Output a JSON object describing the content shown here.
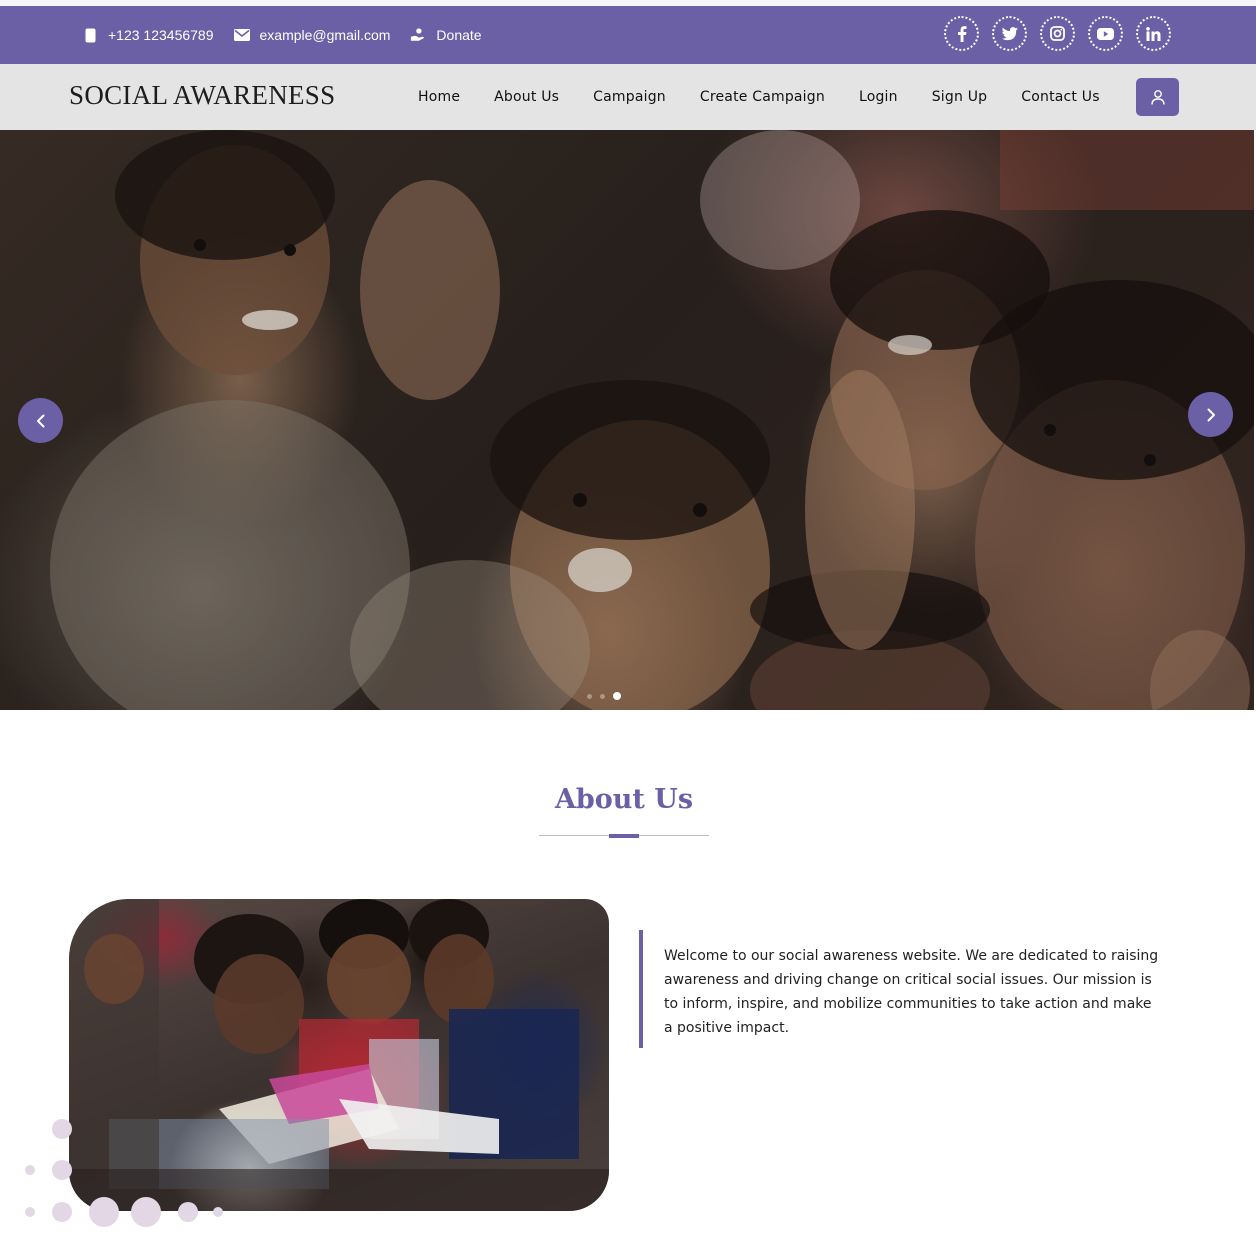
{
  "colors": {
    "accent": "#6b5fa6",
    "navbar_bg": "#e4e4e4",
    "text": "#111111"
  },
  "topbar": {
    "phone": {
      "icon": "mobile-phone-icon",
      "text": "+123 123456789"
    },
    "email": {
      "icon": "envelope-icon",
      "text": "example@gmail.com"
    },
    "donate": {
      "icon": "donate-hand-icon",
      "text": "Donate"
    },
    "socials": [
      "facebook-icon",
      "twitter-icon",
      "instagram-icon",
      "youtube-icon",
      "linkedin-icon"
    ]
  },
  "navbar": {
    "brand": "SOCIAL AWARENESS",
    "links": [
      "Home",
      "About Us",
      "Campaign",
      "Create Campaign",
      "Login",
      "Sign Up",
      "Contact Us"
    ],
    "user_button_icon": "user-icon"
  },
  "hero": {
    "prev_icon": "chevron-left-icon",
    "next_icon": "chevron-right-icon",
    "slide_count": 3,
    "active_slide": 3
  },
  "about": {
    "title": "About Us",
    "text": "Welcome to our social awareness website. We are dedicated to raising awareness and driving change on critical social issues. Our mission is to inform, inspire, and mobilize communities to take action and make a positive impact."
  }
}
